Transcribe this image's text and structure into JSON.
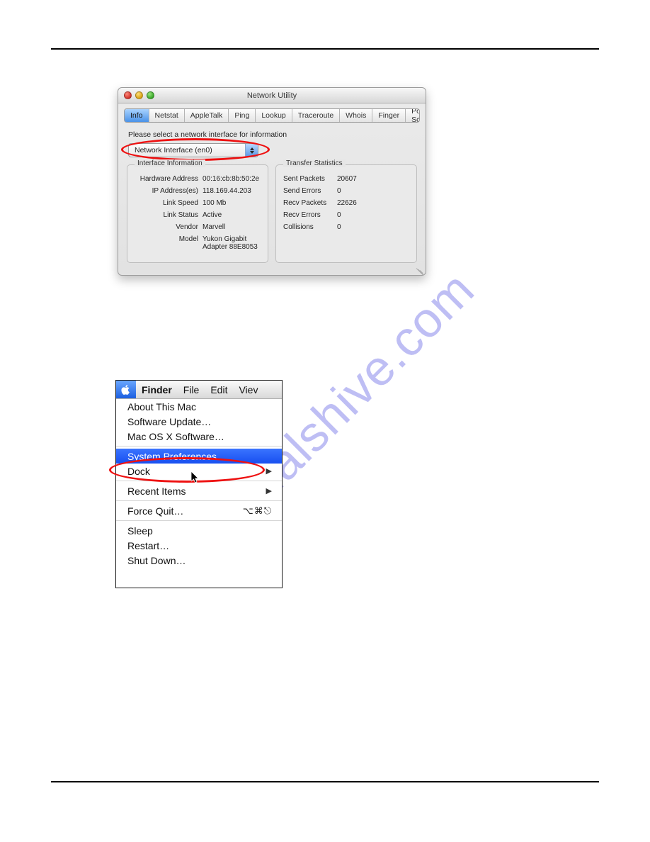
{
  "watermark": "manualshive.com",
  "netutil": {
    "title": "Network Utility",
    "tabs": [
      "Info",
      "Netstat",
      "AppleTalk",
      "Ping",
      "Lookup",
      "Traceroute",
      "Whois",
      "Finger",
      "Port Scan"
    ],
    "active_tab_index": 0,
    "prompt": "Please select a network interface for information",
    "interface_select": "Network Interface (en0)",
    "group_iface_title": "Interface Information",
    "iface": {
      "hw_label": "Hardware Address",
      "hw": "00:16:cb:8b:50:2e",
      "ip_label": "IP Address(es)",
      "ip": "118.169.44.203",
      "speed_label": "Link Speed",
      "speed": "100 Mb",
      "status_label": "Link Status",
      "status": "Active",
      "vendor_label": "Vendor",
      "vendor": "Marvell",
      "model_label": "Model",
      "model": "Yukon Gigabit Adapter 88E8053"
    },
    "group_stats_title": "Transfer Statistics",
    "stats": {
      "sent_label": "Sent Packets",
      "sent": "20607",
      "senderr_label": "Send Errors",
      "senderr": "0",
      "recv_label": "Recv Packets",
      "recv": "22626",
      "recverr_label": "Recv Errors",
      "recverr": "0",
      "coll_label": "Collisions",
      "coll": "0"
    }
  },
  "menu": {
    "menubar": {
      "finder": "Finder",
      "file": "File",
      "edit": "Edit",
      "view": "Viev"
    },
    "items": {
      "about": "About This Mac",
      "swupdate": "Software Update…",
      "osxsoft": "Mac OS X Software…",
      "sysprefs": "System Preferences…",
      "dock": "Dock",
      "recent": "Recent Items",
      "forcequit": "Force Quit…",
      "forcequit_shortcut": "⌥⌘⎋",
      "sleep": "Sleep",
      "restart": "Restart…",
      "shutdown": "Shut Down…"
    }
  }
}
